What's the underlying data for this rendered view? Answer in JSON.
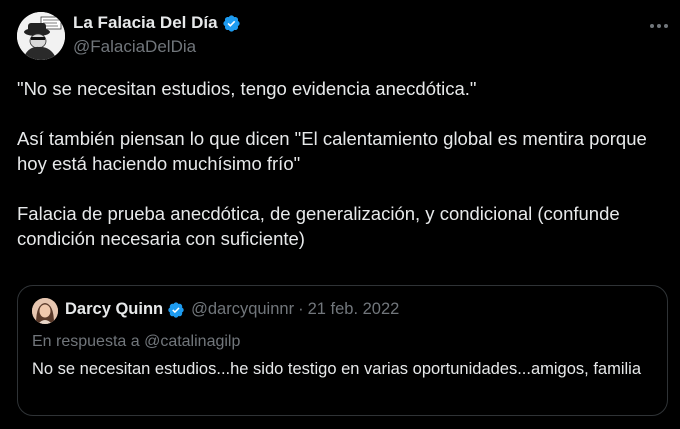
{
  "tweet": {
    "author": {
      "name": "La Falacia Del Día",
      "handle": "@FalaciaDelDia",
      "verified_color": "#1d9bf0"
    },
    "body": [
      "\"No se necesitan estudios, tengo evidencia anecdótica.\"",
      "Así también piensan lo que dicen \"El calentamiento global es mentira porque hoy está haciendo muchísimo frío\"",
      "Falacia de prueba anecdótica, de generalización, y condicional (confunde condición necesaria con suficiente)"
    ]
  },
  "quote": {
    "name": "Darcy Quinn",
    "handle": "@darcyquinnr",
    "separator": "·",
    "date": "21 feb. 2022",
    "reply_to": "En respuesta a @catalinagilp",
    "text": "No se necesitan estudios...he sido testigo en varias oportunidades...amigos, familia"
  },
  "icons": [
    "verified-badge-icon",
    "more-options-icon"
  ]
}
